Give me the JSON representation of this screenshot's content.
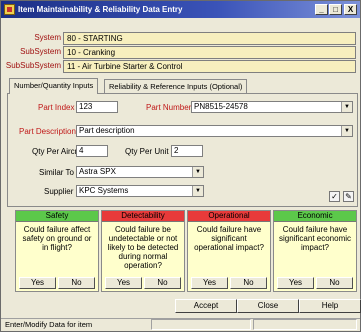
{
  "window": {
    "title": "Item Maintainability & Reliability Data Entry",
    "minimize": "_",
    "maximize": "□",
    "close": "X"
  },
  "header": {
    "system_label": "System",
    "system_value": "80 - STARTING",
    "subsystem_label": "SubSystem",
    "subsystem_value": "10  - Cranking",
    "subsubsystem_label": "SubSubSystem",
    "subsubsystem_value": "11  - Air Turbine Starter & Control"
  },
  "tabs": [
    {
      "label": "Number/Quantity Inputs",
      "active": true
    },
    {
      "label": "Reliability & Reference Inputs (Optional)",
      "active": false
    }
  ],
  "form": {
    "part_index_label": "Part Index",
    "part_index_value": "123",
    "part_number_label": "Part Number",
    "part_number_value": "PN8515-24578",
    "part_description_label": "Part Description",
    "part_description_value": "Part description",
    "qty_per_aircraft_label": "Qty Per Aircraft",
    "qty_per_aircraft_value": "4",
    "qty_per_unit_label": "Qty Per Unit",
    "qty_per_unit_value": "2",
    "similar_to_label": "Similar To",
    "similar_to_value": "Astra SPX",
    "supplier_label": "Supplier",
    "supplier_value": "KPC Systems"
  },
  "criteria": [
    {
      "name": "Safety",
      "color": "#5cc84a",
      "question": "Could failure affect safety on ground or in flight?",
      "yes": "Yes",
      "no": "No"
    },
    {
      "name": "Detectability",
      "color": "#e83a3a",
      "question": "Could failure be undetectable or not likely to be detected during normal operation?",
      "yes": "Yes",
      "no": "No"
    },
    {
      "name": "Operational",
      "color": "#e83a3a",
      "question": "Could failure have significant operational impact?",
      "yes": "Yes",
      "no": "No"
    },
    {
      "name": "Economic",
      "color": "#5cc84a",
      "question": "Could failure have significant economic impact?",
      "yes": "Yes",
      "no": "No"
    }
  ],
  "buttons": {
    "accept": "Accept",
    "close": "Close",
    "help": "Help"
  },
  "status_text": "Enter/Modify Data for item"
}
